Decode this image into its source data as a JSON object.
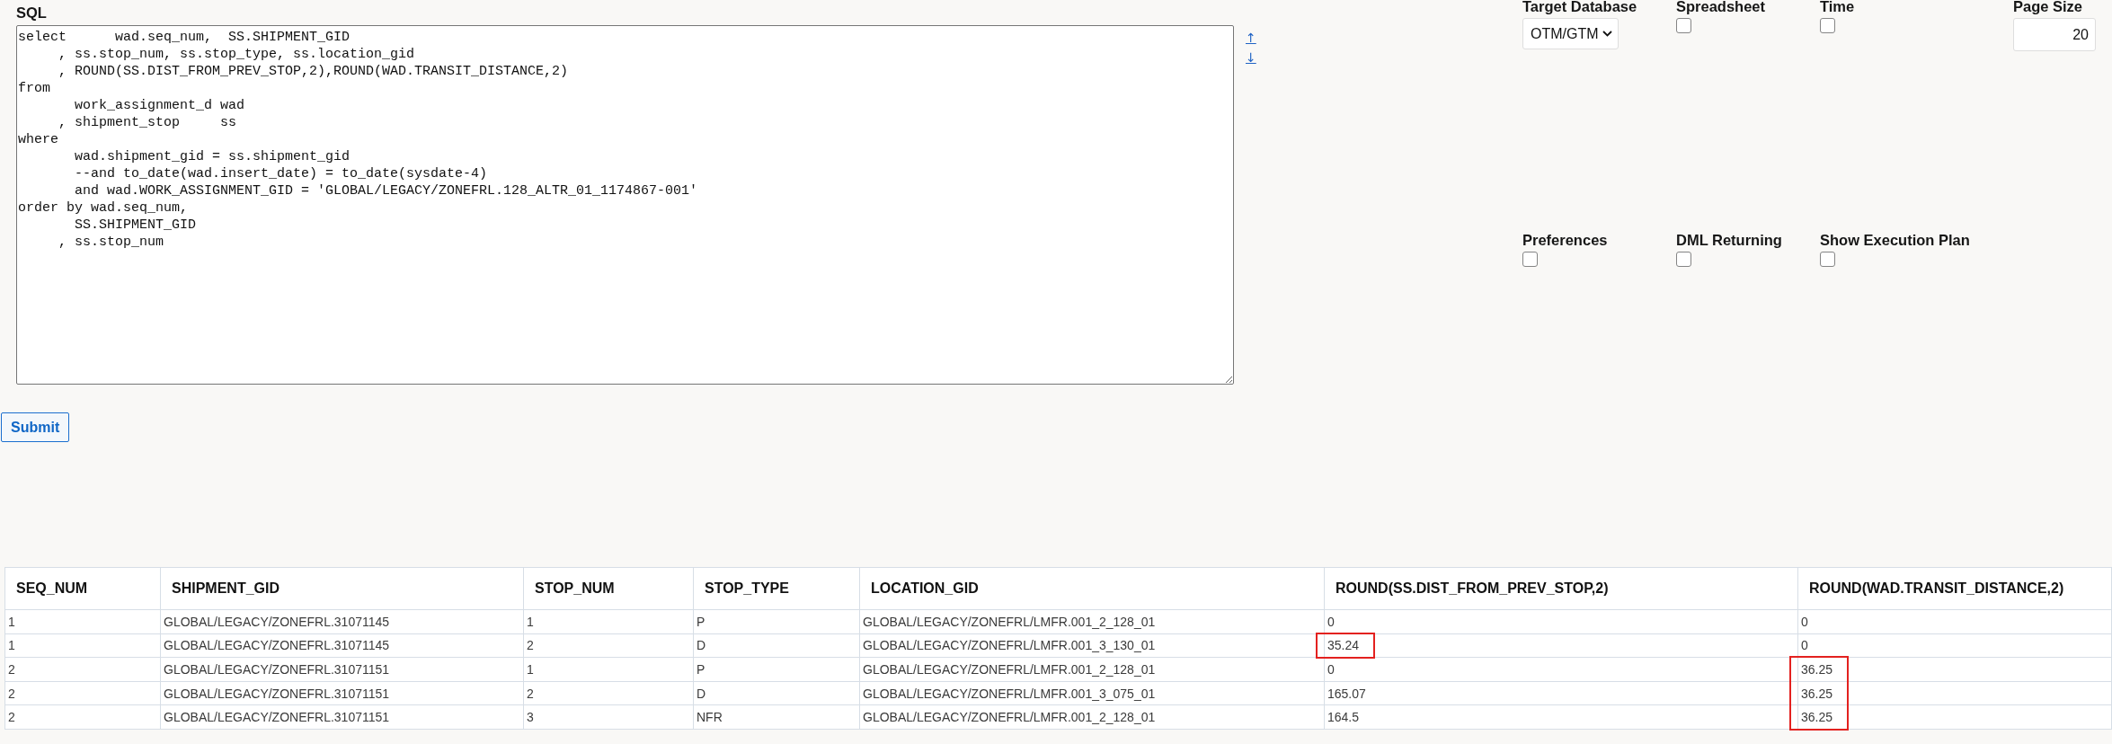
{
  "sql": {
    "label": "SQL",
    "value": "select      wad.seq_num,  SS.SHIPMENT_GID\n     , ss.stop_num, ss.stop_type, ss.location_gid\n     , ROUND(SS.DIST_FROM_PREV_STOP,2),ROUND(WAD.TRANSIT_DISTANCE,2)\nfrom\n       work_assignment_d wad\n     , shipment_stop     ss\nwhere\n       wad.shipment_gid = ss.shipment_gid\n       --and to_date(wad.insert_date) = to_date(sysdate-4)\n       and wad.WORK_ASSIGNMENT_GID = 'GLOBAL/LEGACY/ZONEFRL.128_ALTR_01_1174867-001'\norder by wad.seq_num,\n       SS.SHIPMENT_GID\n     , ss.stop_num",
    "move_links": [
      "↑",
      "↓"
    ]
  },
  "settings": [
    {
      "kind": "select",
      "label": "Target Database",
      "value": "OTM/GTM"
    },
    {
      "kind": "checkbox",
      "label": "Spreadsheet",
      "checked": false
    },
    {
      "kind": "checkbox",
      "label": "Time",
      "checked": false
    },
    {
      "kind": "number",
      "label": "Page Size",
      "value": "20"
    },
    {
      "kind": "checkbox",
      "label": "Preferences",
      "checked": false
    },
    {
      "kind": "checkbox",
      "label": "DML Returning",
      "checked": false
    },
    {
      "kind": "checkbox",
      "label": "Show Execution Plan",
      "checked": false
    }
  ],
  "submit": {
    "label": "Submit"
  },
  "results": {
    "columns": [
      "SEQ_NUM",
      "SHIPMENT_GID",
      "STOP_NUM",
      "STOP_TYPE",
      "LOCATION_GID",
      "ROUND(SS.DIST_FROM_PREV_STOP,2)",
      "ROUND(WAD.TRANSIT_DISTANCE,2)"
    ],
    "rows": [
      {
        "cells": [
          "1",
          "GLOBAL/LEGACY/ZONEFRL.31071145",
          "1",
          "P",
          "GLOBAL/LEGACY/ZONEFRL/LMFR.001_2_128_01",
          "0",
          "0"
        ],
        "boxed": [
          false,
          false,
          false,
          false,
          false,
          false,
          false
        ]
      },
      {
        "cells": [
          "1",
          "GLOBAL/LEGACY/ZONEFRL.31071145",
          "2",
          "D",
          "GLOBAL/LEGACY/ZONEFRL/LMFR.001_3_130_01",
          "35.24",
          "0"
        ],
        "boxed": [
          false,
          false,
          false,
          false,
          false,
          true,
          false
        ]
      },
      {
        "cells": [
          "2",
          "GLOBAL/LEGACY/ZONEFRL.31071151",
          "1",
          "P",
          "GLOBAL/LEGACY/ZONEFRL/LMFR.001_2_128_01",
          "0",
          "36.25"
        ],
        "boxed": [
          false,
          false,
          false,
          false,
          false,
          false,
          true
        ]
      },
      {
        "cells": [
          "2",
          "GLOBAL/LEGACY/ZONEFRL.31071151",
          "2",
          "D",
          "GLOBAL/LEGACY/ZONEFRL/LMFR.001_3_075_01",
          "165.07",
          "36.25"
        ],
        "boxed": [
          false,
          false,
          false,
          false,
          false,
          false,
          true
        ]
      },
      {
        "cells": [
          "2",
          "GLOBAL/LEGACY/ZONEFRL.31071151",
          "3",
          "NFR",
          "GLOBAL/LEGACY/ZONEFRL/LMFR.001_2_128_01",
          "164.5",
          "36.25"
        ],
        "boxed": [
          false,
          false,
          false,
          false,
          false,
          false,
          true
        ]
      }
    ]
  }
}
